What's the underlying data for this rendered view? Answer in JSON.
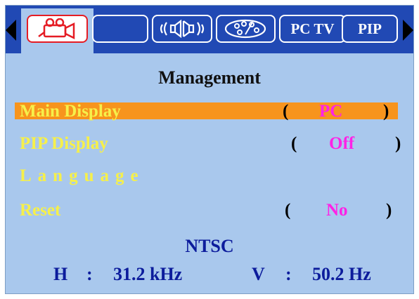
{
  "tabs": [
    {
      "icon": "projector-icon",
      "active": true
    },
    {
      "icon": "blank-icon",
      "active": false
    },
    {
      "icon": "speaker-icon",
      "active": false
    },
    {
      "icon": "palette-icon",
      "active": false
    },
    {
      "label": "PC TV",
      "active": false
    },
    {
      "label": "PIP",
      "active": false
    }
  ],
  "menu": {
    "title": "Management",
    "items": [
      {
        "label": "Main Display",
        "value": "PC",
        "selected": true
      },
      {
        "label": "PIP Display",
        "value": "Off",
        "selected": false
      },
      {
        "label": "Language",
        "value": "",
        "selected": false
      },
      {
        "label": "Reset",
        "value": "No",
        "selected": false
      }
    ],
    "paren_open": "(",
    "paren_close": ")"
  },
  "signal": {
    "standard": "NTSC",
    "h_label": "H",
    "h_value": "31.2 kHz",
    "v_label": "V",
    "v_value": "50.2 Hz",
    "separator": ":"
  },
  "colors": {
    "tab_bar": "#2149b4",
    "panel": "#a9c8ed",
    "highlight": "#f7941d",
    "label": "#f6f04a",
    "value": "#ff22e6",
    "info": "#0c1c9c",
    "active_tab_border": "#e51c24"
  }
}
